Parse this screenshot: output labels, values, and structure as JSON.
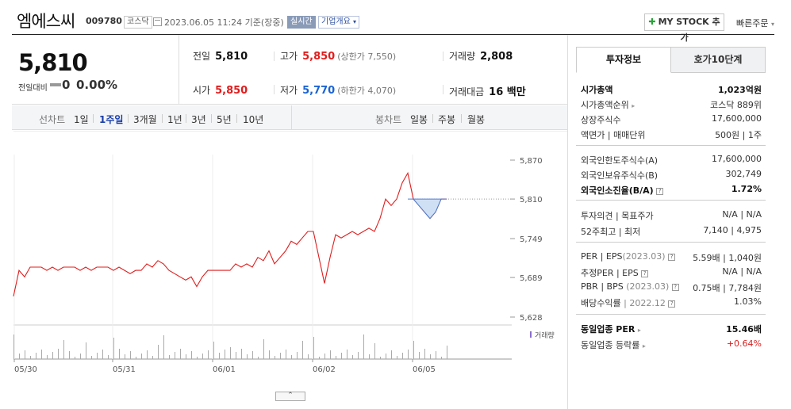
{
  "header": {
    "name": "엠에스씨",
    "code": "009780",
    "market": "코스닥",
    "datetime": "2023.06.05 11:24 기준(장중)",
    "live_badge": "실시간",
    "corp_info": "기업개요",
    "mystock_label": "MY STOCK 추가",
    "quick_order": "빠른주문"
  },
  "price": {
    "current": "5,810",
    "change_label": "전일대비",
    "change": "0",
    "change_rate": "0.00%"
  },
  "quote": {
    "prev_close_label": "전일",
    "prev_close": "5,810",
    "open_label": "시가",
    "open": "5,850",
    "high_label": "고가",
    "high": "5,850",
    "upper_limit": "(상한가 7,550)",
    "low_label": "저가",
    "low": "5,770",
    "lower_limit": "(하한가 4,070)",
    "volume_label": "거래량",
    "volume": "2,808",
    "amount_label": "거래대금",
    "amount": "16 백만"
  },
  "period_tabs": {
    "line_label": "선차트",
    "line_items": [
      "1일",
      "1주일",
      "3개월",
      "1년",
      "3년",
      "5년",
      "10년"
    ],
    "active": "1주일",
    "candle_label": "봉차트",
    "candle_items": [
      "일봉",
      "주봉",
      "월봉"
    ]
  },
  "right_panel": {
    "tab_active": "투자정보",
    "tab_other": "호가10단계",
    "rows": {
      "mktcap_label": "시가총액",
      "mktcap": "1,023억원",
      "mktcap_rank_label": "시가총액순위",
      "mktcap_rank": "코스닥 889위",
      "shares_label": "상장주식수",
      "shares": "17,600,000",
      "par_label": "액면가 | 매매단위",
      "par": "500원 | 1주",
      "foreign_limit_label": "외국인한도주식수(A)",
      "foreign_limit": "17,600,000",
      "foreign_hold_label": "외국인보유주식수(B)",
      "foreign_hold": "302,749",
      "foreign_ratio_label": "외국인소진율(B/A)",
      "foreign_ratio": "1.72%",
      "opinion_label": "투자의견 | 목표주가",
      "opinion": "N/A | N/A",
      "wk52_label": "52주최고 | 최저",
      "wk52": "7,140 | 4,975",
      "per_label": "PER | EPS",
      "per_year": "(2023.03)",
      "per": "5.59배 | 1,040원",
      "est_per_label": "추정PER | EPS",
      "est_per": "N/A | N/A",
      "pbr_label": "PBR | BPS",
      "pbr_year": "(2023.03)",
      "pbr": "0.75배 | 7,784원",
      "div_label": "배당수익률",
      "div_year": "2022.12",
      "div": "1.03%",
      "industry_per_label": "동일업종 PER",
      "industry_per": "15.46배",
      "industry_chg_label": "동일업종 등락률",
      "industry_chg": "+0.64%"
    }
  },
  "chart_data": {
    "type": "line",
    "title": "",
    "y_ticks": [
      "5,870",
      "5,810",
      "5,749",
      "5,689",
      "5,628"
    ],
    "x_ticks": [
      "05/30",
      "05/31",
      "06/01",
      "06/02",
      "06/05"
    ],
    "ylim": [
      5628,
      5870
    ],
    "reference_price": 5810,
    "volume_legend": "거래량",
    "series": [
      {
        "values": [
          5660,
          5700,
          5690,
          5705,
          5705,
          5705,
          5700,
          5705,
          5700,
          5705,
          5705,
          5705,
          5700,
          5705,
          5700,
          5705,
          5705,
          5705,
          5700,
          5705,
          5700,
          5695,
          5700,
          5700,
          5710,
          5705,
          5715,
          5710,
          5700,
          5695,
          5690,
          5685,
          5690,
          5675,
          5690,
          5700,
          5700,
          5700,
          5700,
          5700,
          5710,
          5705,
          5710,
          5705,
          5720,
          5715,
          5730,
          5710,
          5720,
          5730,
          5745,
          5740,
          5750,
          5760,
          5760,
          5720,
          5680,
          5720,
          5755,
          5750,
          5755,
          5760,
          5755,
          5760,
          5765,
          5760,
          5780,
          5810,
          5800,
          5810,
          5835,
          5850,
          5810,
          5800,
          5790,
          5780,
          5790,
          5810,
          5810
        ]
      }
    ]
  }
}
